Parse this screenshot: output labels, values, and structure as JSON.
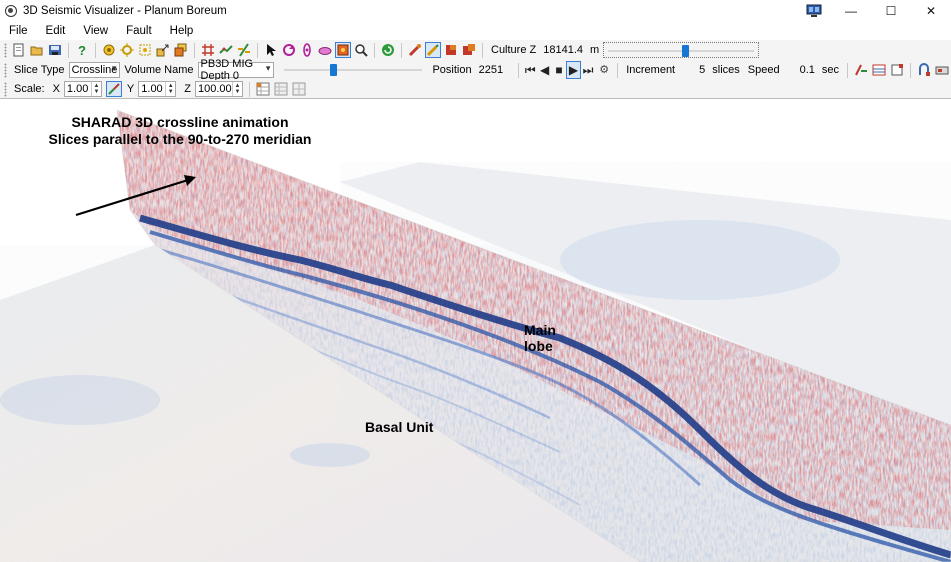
{
  "window": {
    "title": "3D Seismic Visualizer - Planum Boreum",
    "controls": [
      "—",
      "☐",
      "✕"
    ]
  },
  "menu": [
    "File",
    "Edit",
    "View",
    "Fault",
    "Help"
  ],
  "toolbar1": {
    "culture_label": "Culture Z",
    "culture_value": "18141.4",
    "culture_unit": "m",
    "culture_slider_fraction": 0.53
  },
  "toolbar2": {
    "slice_type_label": "Slice Type",
    "slice_type_value": "Crossline",
    "volume_name_label": "Volume Name",
    "volume_name_value": "PB3D MIG Depth 0",
    "position_slider_fraction": 0.36,
    "position_label": "Position",
    "position_value": "2251",
    "increment_label": "Increment",
    "increment_value": "5",
    "increment_unit": "slices",
    "speed_label": "Speed",
    "speed_value": "0.1",
    "speed_unit": "sec"
  },
  "toolbar3": {
    "scale_label": "Scale:",
    "x_label": "X",
    "x_value": "1.00",
    "y_label": "Y",
    "y_value": "1.00",
    "z_label": "Z",
    "z_value": "100.00"
  },
  "annotations": {
    "title_line1": "SHARAD 3D crossline animation",
    "title_line2": "Slices parallel to the 90-to-270 meridian",
    "main_lobe_line1": "Main",
    "main_lobe_line2": "lobe",
    "basal_unit": "Basal Unit"
  },
  "icons": {
    "toolbar1_a": [
      "new-file-icon",
      "open-folder-icon",
      "save-icon",
      "help-icon"
    ],
    "toolbar1_b": [
      "seed-point-icon",
      "pick-target-icon",
      "select-region-icon",
      "export-icon",
      "layers-icon"
    ],
    "toolbar1_c": [
      "grid-icon",
      "horizon-icon",
      "fault-icon"
    ],
    "toolbar1_d": [
      "pointer-icon",
      "rotate-icon",
      "orbit-icon",
      "pan-icon",
      "zoom-box-icon",
      "zoom-icon",
      "refresh-view-icon"
    ],
    "toolbar1_e": [
      "color-bar-icon",
      "color-edit-icon",
      "color-palette-icon",
      "color-apply-icon"
    ],
    "toolbar2_end": [
      "slice-horizon-icon",
      "slice-fault-icon",
      "slice-table-icon",
      "link-icon",
      "camera-icon"
    ],
    "toolbar3_end": [
      "grid-view-icon",
      "table-view-icon",
      "split-view-icon"
    ]
  },
  "colors": {
    "seismic_positive": "#c62828",
    "seismic_negative": "#1a3f8f",
    "slider_thumb": "#1677d2"
  }
}
